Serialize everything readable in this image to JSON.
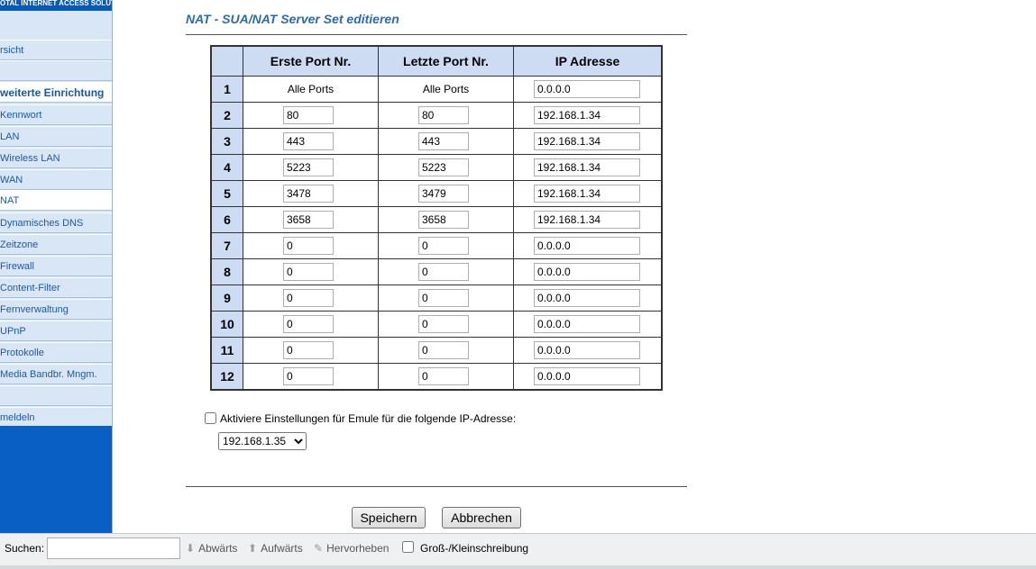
{
  "sidebar": {
    "logo_text": "OTAL INTERNET ACCESS SOLUTION",
    "items": [
      {
        "label": "rsicht"
      },
      {
        "label": ""
      },
      {
        "label": "weiterte Einrichtung"
      },
      {
        "label": "Kennwort"
      },
      {
        "label": "LAN"
      },
      {
        "label": "Wireless LAN"
      },
      {
        "label": "WAN"
      },
      {
        "label": "NAT"
      },
      {
        "label": "Dynamisches DNS"
      },
      {
        "label": "Zeitzone"
      },
      {
        "label": "Firewall"
      },
      {
        "label": "Content-Filter"
      },
      {
        "label": "Fernverwaltung"
      },
      {
        "label": "UPnP"
      },
      {
        "label": "Protokolle"
      },
      {
        "label": "Media Bandbr. Mngm."
      },
      {
        "label": ""
      },
      {
        "label": "meldeln"
      }
    ]
  },
  "main": {
    "title": "NAT - SUA/NAT Server Set editieren",
    "table": {
      "headers": {
        "first_port": "Erste Port Nr.",
        "last_port": "Letzte Port Nr.",
        "ip": "IP Adresse"
      },
      "rows": [
        {
          "n": "1",
          "first": "Alle Ports",
          "last": "Alle Ports",
          "ip": "0.0.0.0"
        },
        {
          "n": "2",
          "first": "80",
          "last": "80",
          "ip": "192.168.1.34"
        },
        {
          "n": "3",
          "first": "443",
          "last": "443",
          "ip": "192.168.1.34"
        },
        {
          "n": "4",
          "first": "5223",
          "last": "5223",
          "ip": "192.168.1.34"
        },
        {
          "n": "5",
          "first": "3478",
          "last": "3479",
          "ip": "192.168.1.34"
        },
        {
          "n": "6",
          "first": "3658",
          "last": "3658",
          "ip": "192.168.1.34"
        },
        {
          "n": "7",
          "first": "0",
          "last": "0",
          "ip": "0.0.0.0"
        },
        {
          "n": "8",
          "first": "0",
          "last": "0",
          "ip": "0.0.0.0"
        },
        {
          "n": "9",
          "first": "0",
          "last": "0",
          "ip": "0.0.0.0"
        },
        {
          "n": "10",
          "first": "0",
          "last": "0",
          "ip": "0.0.0.0"
        },
        {
          "n": "11",
          "first": "0",
          "last": "0",
          "ip": "0.0.0.0"
        },
        {
          "n": "12",
          "first": "0",
          "last": "0",
          "ip": "0.0.0.0"
        }
      ]
    },
    "emule": {
      "label": "Aktiviere Einstellungen für Emule für die folgende IP-Adresse:",
      "selected_ip": "192.168.1.35"
    },
    "buttons": {
      "save": "Speichern",
      "cancel": "Abbrechen"
    }
  },
  "findbar": {
    "label": "Suchen:",
    "down": "Abwärts",
    "up": "Aufwärts",
    "highlight": "Hervorheben",
    "case": "Groß-/Kleinschreibung"
  }
}
